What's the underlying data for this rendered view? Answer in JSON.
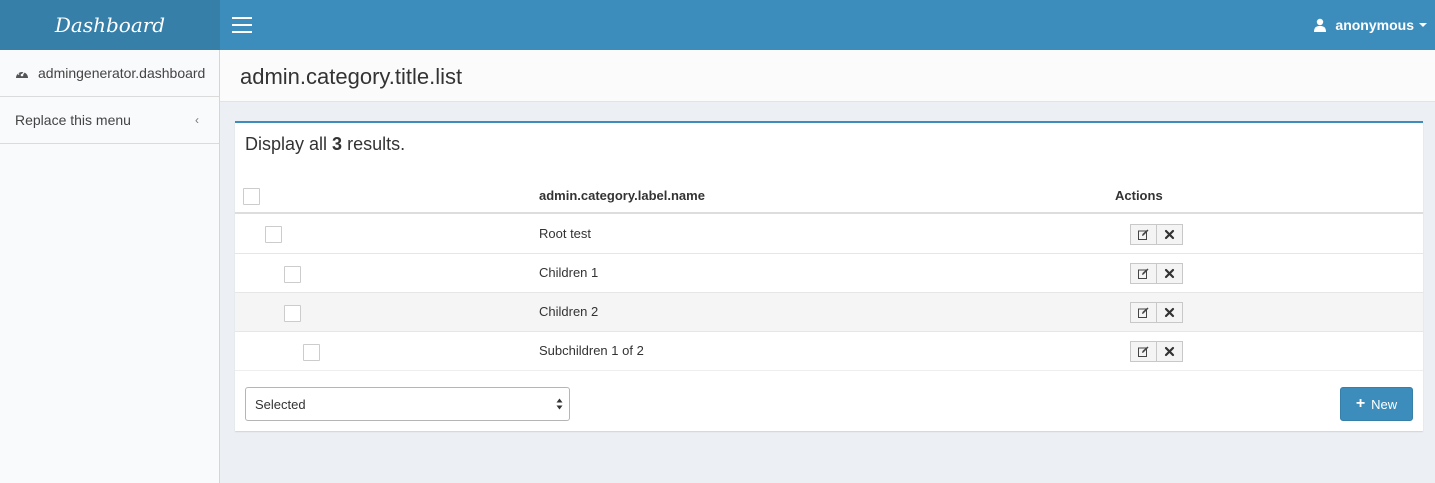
{
  "header": {
    "logo": "Dashboard",
    "menu_toggle_icon": "hamburger-icon",
    "user": {
      "name": "anonymous",
      "icon": "user-icon"
    }
  },
  "sidebar": {
    "items": [
      {
        "label": "admingenerator.dashboard",
        "icon": "dashboard-icon"
      },
      {
        "label": "Replace this menu",
        "icon": "chevron-left-icon"
      }
    ]
  },
  "page": {
    "title": "admin.category.title.list"
  },
  "list": {
    "summary_prefix": "Display all",
    "count": "3",
    "summary_suffix": "results.",
    "columns": {
      "name": "admin.category.label.name",
      "actions": "Actions"
    },
    "rows": [
      {
        "name": "Root test",
        "depth": 0
      },
      {
        "name": "Children 1",
        "depth": 1
      },
      {
        "name": "Children 2",
        "depth": 1
      },
      {
        "name": "Subchildren 1 of 2",
        "depth": 2
      }
    ],
    "row_actions": [
      "edit-icon",
      "delete-icon"
    ],
    "bulk_select": {
      "value": "Selected"
    },
    "new_button": {
      "label": "New",
      "icon": "plus-icon"
    }
  },
  "colors": {
    "brand": "#3c8dbc",
    "brand_dark": "#367fa9",
    "background": "#ecf0f5"
  }
}
